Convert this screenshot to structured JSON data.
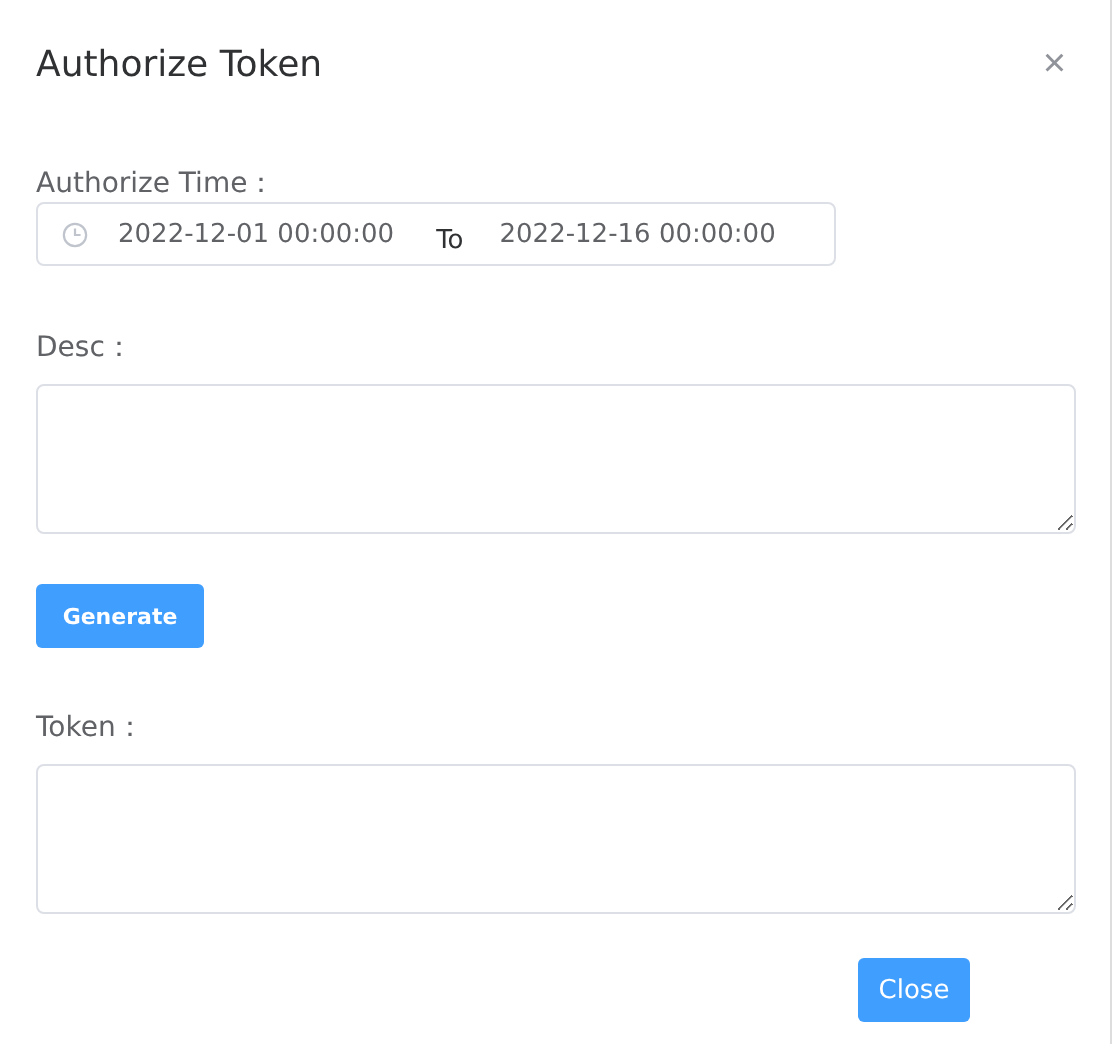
{
  "dialog": {
    "title": "Authorize Token",
    "close_icon": "×"
  },
  "authorize_time": {
    "label": "Authorize Time：",
    "start": "2022-12-01 00:00:00",
    "separator": "To",
    "end": "2022-12-16 00:00:00"
  },
  "desc": {
    "label": "Desc："
  },
  "generate_button": "Generate",
  "token": {
    "label": "Token："
  },
  "close_button": "Close"
}
